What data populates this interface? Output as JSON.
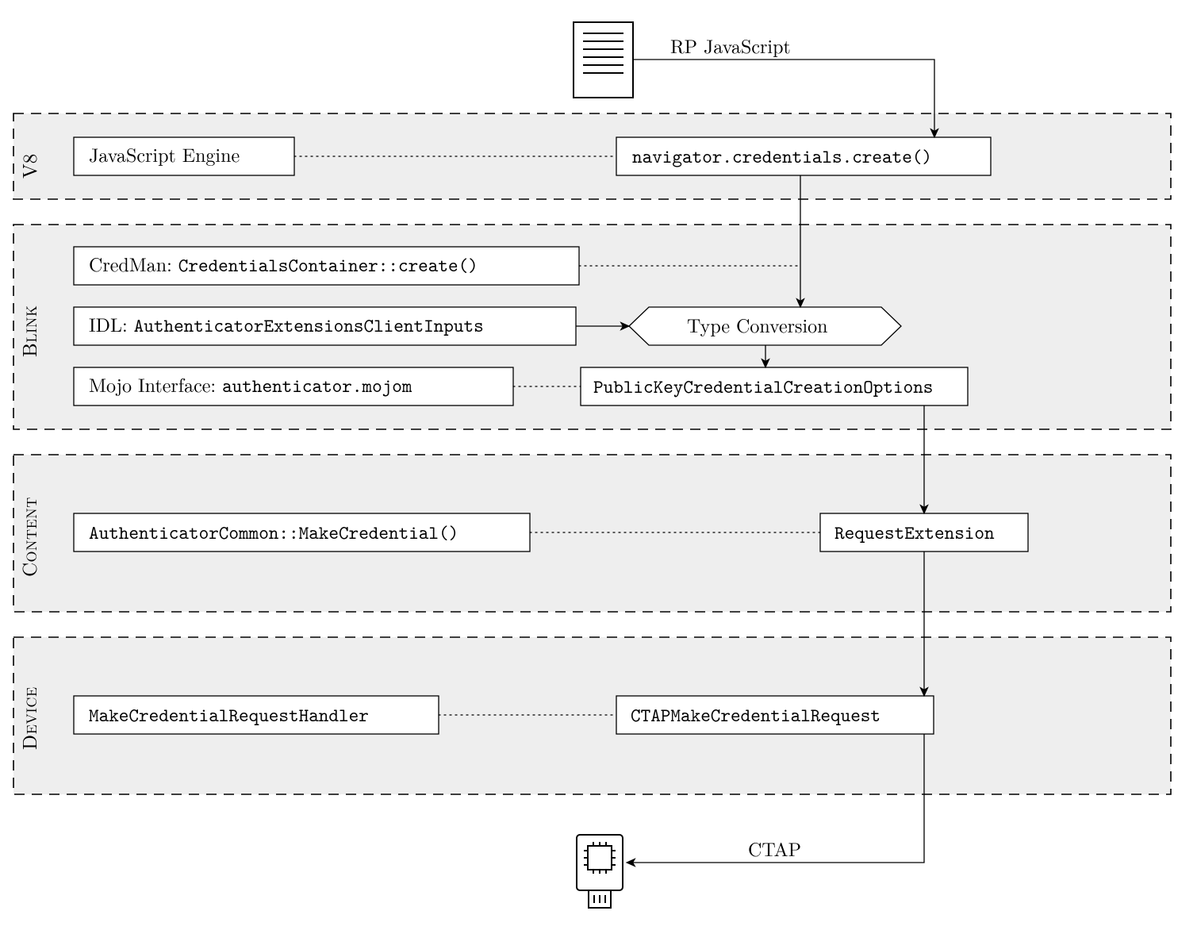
{
  "top_label": "RP JavaScript",
  "bottom_label": "CTAP",
  "layers": {
    "v8": {
      "title": "V8",
      "left_box": "JavaScript Engine",
      "right_box": "navigator.credentials.create()"
    },
    "blink": {
      "title": "Blink",
      "credman_prefix": "CredMan: ",
      "credman_code": "CredentialsContainer::create()",
      "idl_prefix": "IDL: ",
      "idl_code": "AuthenticatorExtensionsClientInputs",
      "mojo_prefix": "Mojo Interface: ",
      "mojo_code": "authenticator.mojom",
      "typeconv": "Type Conversion",
      "pkcc": "PublicKeyCredentialCreationOptions"
    },
    "content": {
      "title": "Content",
      "left_box": "AuthenticatorCommon::MakeCredential()",
      "right_box": "RequestExtension"
    },
    "device": {
      "title": "Device",
      "left_box": "MakeCredentialRequestHandler",
      "right_box": "CTAPMakeCredentialRequest"
    }
  }
}
